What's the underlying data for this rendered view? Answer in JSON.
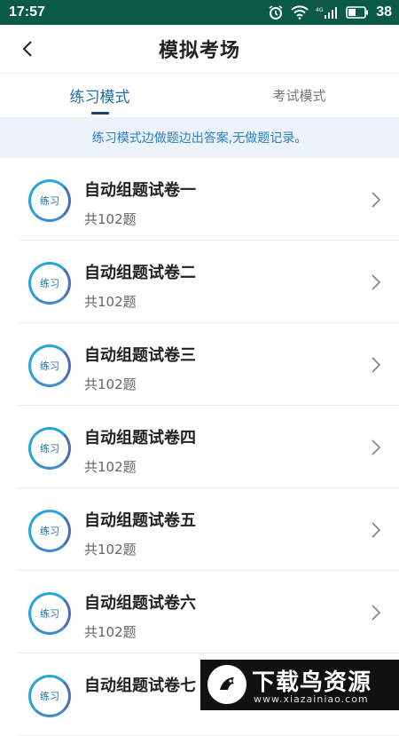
{
  "status_bar": {
    "time": "17:57",
    "battery_level": "38",
    "network_label": "4G",
    "icons": [
      "alarm-icon",
      "wifi-icon",
      "signal-icon",
      "battery-icon"
    ]
  },
  "header": {
    "title": "模拟考场",
    "back_icon": "chevron-left-icon"
  },
  "tabs": [
    {
      "label": "练习模式",
      "active": true
    },
    {
      "label": "考试模式",
      "active": false
    }
  ],
  "notice": "练习模式边做题边出答案,无做题记录。",
  "papers": [
    {
      "badge": "练习",
      "title": "自动组题试卷一",
      "count": "共102题"
    },
    {
      "badge": "练习",
      "title": "自动组题试卷二",
      "count": "共102题"
    },
    {
      "badge": "练习",
      "title": "自动组题试卷三",
      "count": "共102题"
    },
    {
      "badge": "练习",
      "title": "自动组题试卷四",
      "count": "共102题"
    },
    {
      "badge": "练习",
      "title": "自动组题试卷五",
      "count": "共102题"
    },
    {
      "badge": "练习",
      "title": "自动组题试卷六",
      "count": "共102题"
    },
    {
      "badge": "练习",
      "title": "自动组题试卷七",
      "count": ""
    }
  ],
  "watermark": {
    "text": "下载鸟资源",
    "url": "www.xiazainiao.com"
  },
  "colors": {
    "status_bar": "#0b5a43",
    "accent": "#1b6ea5",
    "notice_bg": "#ecf3fa",
    "badge_ring": "#2aa3d9"
  }
}
